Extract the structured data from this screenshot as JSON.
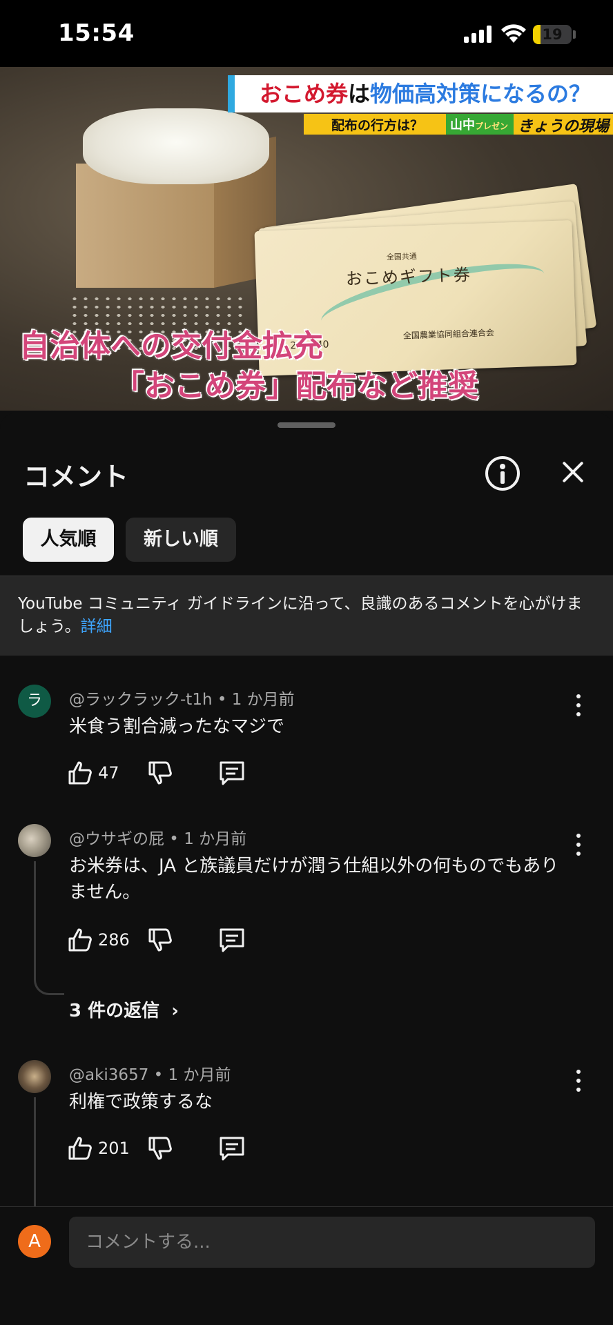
{
  "status_bar": {
    "time": "15:54",
    "battery": "19",
    "battery_level": 0.19,
    "icons": [
      "signal-icon",
      "wifi-icon",
      "battery-icon"
    ]
  },
  "video": {
    "headline_part1": "おこめ券",
    "headline_part2": "は",
    "headline_part3": "物価高対策になるの？",
    "subheadline": "配布の行方は？",
    "presenter": "山中",
    "presenter_suffix": "プレゼン",
    "show_logo": "きょうの現場",
    "ticket_small": "全国共通",
    "ticket_title": "おこめギフト券",
    "ticket_number": "20−440",
    "ticket_issuer": "全国農業協同組合連合会",
    "caption_line1": "自治体への交付金拡充",
    "caption_line2": "「おこめ券」配布など推奨",
    "progress": 0.04,
    "colors": {
      "accent_red": "#d3182e",
      "accent_blue": "#2c7be0",
      "caption_pink": "#d3457a",
      "progress_red": "#ff0000"
    }
  },
  "comments_panel": {
    "title": "コメント",
    "sort_chips": [
      "人気順",
      "新しい順"
    ],
    "active_sort": "人気順",
    "notice_text": "YouTube コミュニティ ガイドラインに沿って、良識のあるコメントを心がけましょう。",
    "notice_link": "詳細"
  },
  "comments": [
    {
      "avatar_letter": "ラ",
      "author_meta": "@ラックラック-t1h • 1 か月前",
      "text": "米食う割合減ったなマジで",
      "likes": "47"
    },
    {
      "avatar_letter": "",
      "author_meta": "@ウサギの屁 • 1 か月前",
      "text": "お米券は、JA と族議員だけが潤う仕組以外の何ものでもありません。",
      "likes": "286",
      "replies_label": "3 件の返信"
    },
    {
      "avatar_letter": "",
      "author_meta": "@aki3657 • 1 か月前",
      "text": "利権で政策するな",
      "likes": "201"
    }
  ],
  "input_bar": {
    "avatar_letter": "A",
    "placeholder": "コメントする..."
  }
}
